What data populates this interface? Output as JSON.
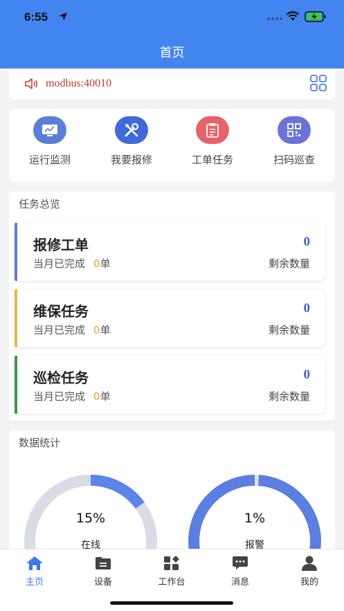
{
  "status_bar": {
    "time": "6:55"
  },
  "header": {
    "title": "首页"
  },
  "notice": {
    "text": "modbus:40010"
  },
  "quick_actions": [
    {
      "label": "运行监测",
      "icon": "monitor-icon",
      "color": "#5b7fd6"
    },
    {
      "label": "我要报修",
      "icon": "repair-tools-icon",
      "color": "#3f6ad8"
    },
    {
      "label": "工单任务",
      "icon": "clipboard-icon",
      "color": "#e8626a"
    },
    {
      "label": "扫码巡查",
      "icon": "qrcode-icon",
      "color": "#6b73d9"
    }
  ],
  "task_overview": {
    "title": "任务总览",
    "items": [
      {
        "name": "报修工单",
        "sub_label": "当月已完成",
        "done": "0",
        "unit": "单",
        "count": "0",
        "remain_label": "剩余数量",
        "color": "#5b7fd6"
      },
      {
        "name": "维保任务",
        "sub_label": "当月已完成",
        "done": "0",
        "unit": "单",
        "count": "0",
        "remain_label": "剩余数量",
        "color": "#e8b64c"
      },
      {
        "name": "巡检任务",
        "sub_label": "当月已完成",
        "done": "0",
        "unit": "单",
        "count": "0",
        "remain_label": "剩余数量",
        "color": "#3a9a4a"
      }
    ]
  },
  "stats": {
    "title": "数据统计",
    "gauges": [
      {
        "percent": "15%",
        "label": "在线",
        "value": 0.15,
        "color": "#5b85e8",
        "track": "#d9dce6"
      },
      {
        "percent": "1%",
        "label": "报警",
        "value": 0.01,
        "color": "#5b7fe0",
        "track": "#d9dce6"
      }
    ]
  },
  "tabbar": {
    "tabs": [
      {
        "label": "主页",
        "icon": "home-icon",
        "active": true
      },
      {
        "label": "设备",
        "icon": "device-folder-icon",
        "active": false
      },
      {
        "label": "工作台",
        "icon": "workbench-icon",
        "active": false
      },
      {
        "label": "消息",
        "icon": "message-icon",
        "active": false
      },
      {
        "label": "我的",
        "icon": "profile-icon",
        "active": false
      }
    ]
  },
  "colors": {
    "primary": "#4285f0",
    "accent_orange": "#f0a020",
    "count_blue": "#3f64c8",
    "notice_red": "#c0392b"
  }
}
